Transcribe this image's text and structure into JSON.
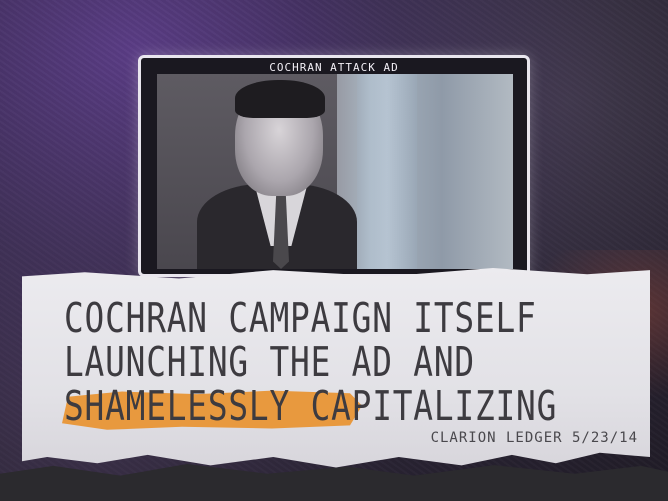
{
  "screen": {
    "title": "COCHRAN ATTACK AD"
  },
  "headline": {
    "line1": "COCHRAN CAMPAIGN ITSELF",
    "line2": "LAUNCHING THE AD AND",
    "line3": "SHAMELESSLY CAPITALIZING"
  },
  "source": "CLARION LEDGER 5/23/14",
  "colors": {
    "highlight": "#e89230",
    "ink": "#3d3b40",
    "background": "#3a2c52"
  }
}
